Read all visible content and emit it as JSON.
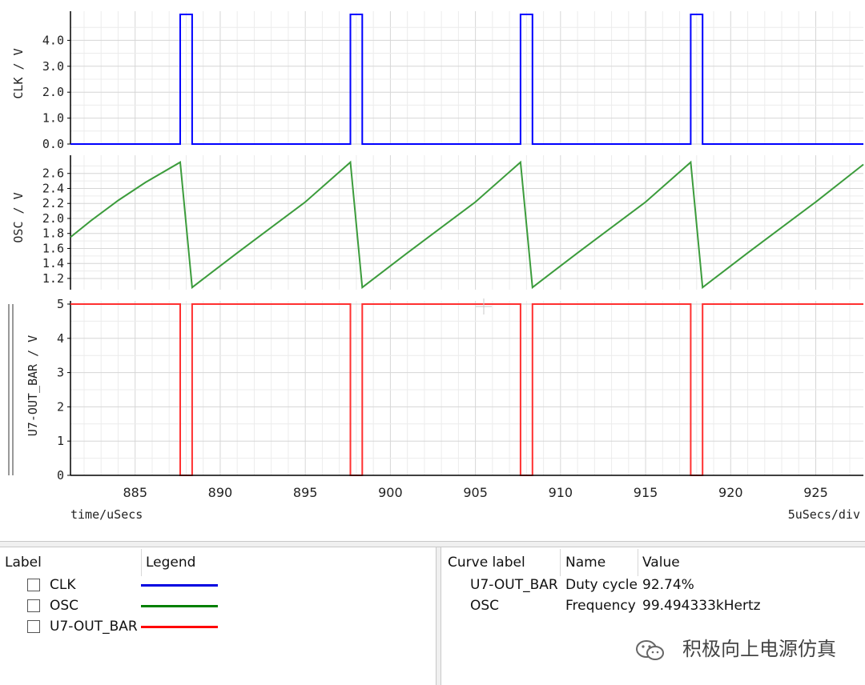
{
  "plot": {
    "x_axis_label": "time/uSecs",
    "x_div_label": "5uSecs/div",
    "x_ticks": [
      "885",
      "890",
      "895",
      "900",
      "905",
      "910",
      "915",
      "920",
      "925"
    ]
  },
  "chart_data": [
    {
      "type": "line",
      "ylabel": "CLK / V",
      "ytick_labels": [
        "0.0",
        "1.0",
        "2.0",
        "3.0",
        "4.0"
      ],
      "x": [
        881.2,
        887.65,
        887.65,
        888.35,
        888.35,
        897.65,
        897.65,
        898.35,
        898.35,
        907.65,
        907.65,
        908.35,
        908.35,
        917.65,
        917.65,
        918.35,
        918.35,
        927.8
      ],
      "series": [
        {
          "name": "CLK",
          "color": "#0000ff",
          "values": [
            0,
            0,
            5,
            5,
            0,
            0,
            5,
            5,
            0,
            0,
            5,
            5,
            0,
            0,
            5,
            5,
            0,
            0
          ]
        }
      ],
      "ylim": [
        0,
        5
      ]
    },
    {
      "type": "line",
      "ylabel": "OSC / V",
      "ytick_labels": [
        "1.2",
        "1.4",
        "1.6",
        "1.8",
        "2.0",
        "2.2",
        "2.4",
        "2.6"
      ],
      "x": [
        881.2,
        882.4,
        884.0,
        885.6,
        887.65,
        888.35,
        889.5,
        891.0,
        893.0,
        895.0,
        897.65,
        898.35,
        899.5,
        901.0,
        903.0,
        905.0,
        907.65,
        908.35,
        909.5,
        911.0,
        913.0,
        915.0,
        917.65,
        918.35,
        919.5,
        921.0,
        923.0,
        925.0,
        927.8
      ],
      "series": [
        {
          "name": "OSC",
          "color": "#3c9c3c",
          "values": [
            1.75,
            1.97,
            2.24,
            2.48,
            2.75,
            1.08,
            1.28,
            1.54,
            1.88,
            2.22,
            2.75,
            1.08,
            1.28,
            1.54,
            1.88,
            2.22,
            2.75,
            1.08,
            1.28,
            1.54,
            1.88,
            2.22,
            2.75,
            1.08,
            1.28,
            1.54,
            1.88,
            2.22,
            2.72
          ]
        }
      ],
      "ylim": [
        1.05,
        2.8
      ]
    },
    {
      "type": "line",
      "ylabel": "U7-OUT_BAR / V",
      "ytick_labels": [
        "0",
        "1",
        "2",
        "3",
        "4",
        "5"
      ],
      "x": [
        881.2,
        887.65,
        887.65,
        888.35,
        888.35,
        897.65,
        897.65,
        898.35,
        898.35,
        907.65,
        907.65,
        908.35,
        908.35,
        917.65,
        917.65,
        918.35,
        918.35,
        927.8
      ],
      "series": [
        {
          "name": "U7-OUT_BAR",
          "color": "#ff3030",
          "values": [
            5,
            5,
            0,
            0,
            5,
            5,
            0,
            0,
            5,
            5,
            0,
            0,
            5,
            5,
            0,
            0,
            5,
            5
          ]
        }
      ],
      "ylim": [
        0,
        5
      ]
    }
  ],
  "legend_panel": {
    "header_label": "Label",
    "header_legend": "Legend",
    "items": [
      {
        "label": "CLK",
        "color": "#0000e0"
      },
      {
        "label": "OSC",
        "color": "#008000"
      },
      {
        "label": "U7-OUT_BAR",
        "color": "#ff0000"
      }
    ]
  },
  "measure_panel": {
    "header_curve": "Curve label",
    "header_name": "Name",
    "header_value": "Value",
    "rows": [
      {
        "curve": "U7-OUT_BAR",
        "name": "Duty cycle",
        "value": "92.74%"
      },
      {
        "curve": "OSC",
        "name": "Frequency",
        "value": "99.494333kHertz"
      }
    ]
  },
  "watermark": {
    "text": "积极向上电源仿真",
    "icon": "wechat-icon"
  }
}
